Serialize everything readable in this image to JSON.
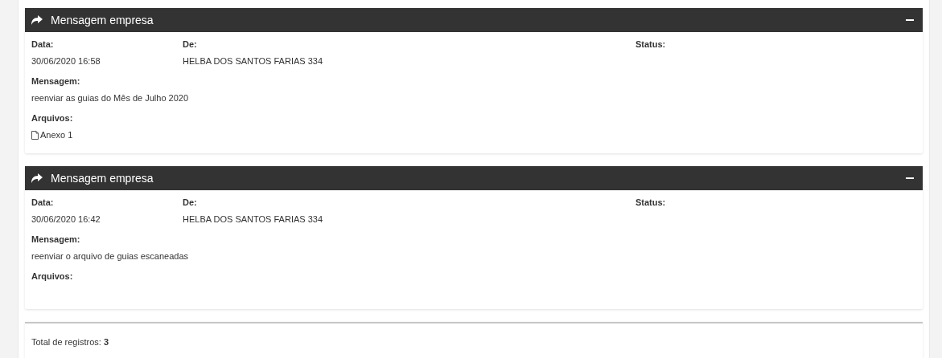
{
  "messages": [
    {
      "title": "Mensagem empresa",
      "expanded": true,
      "fields": [
        {
          "label": "Data:",
          "value": "30/06/2020 16:58"
        },
        {
          "label": "De:",
          "value": "HELBA DOS SANTOS FARIAS 334"
        },
        {
          "label": "Status:"
        }
      ],
      "message_label": "Mensagem:",
      "message": "reenviar as guias do Mês de Julho 2020",
      "files_label": "Arquivos:",
      "files": [
        "Anexo 1"
      ]
    },
    {
      "title": "Mensagem empresa",
      "expanded": true,
      "fields": [
        {
          "label": "Data:",
          "value": "30/06/2020 16:42"
        },
        {
          "label": "De:",
          "value": "HELBA DOS SANTOS FARIAS 334"
        },
        {
          "label": "Status:"
        }
      ],
      "message_label": "Mensagem:",
      "message": "reenviar o arquivo de guias escaneadas",
      "files_label": "Arquivos:"
    }
  ],
  "footer": {
    "total": "Total de registros: **3**"
  }
}
